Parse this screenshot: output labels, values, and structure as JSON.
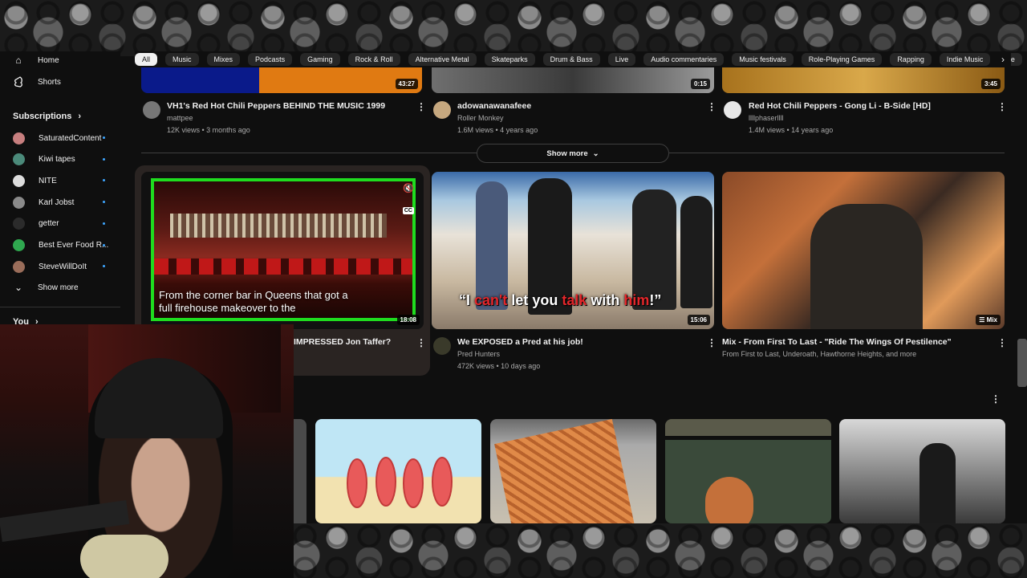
{
  "sidebar": {
    "home": "Home",
    "shorts": "Shorts",
    "subscriptions_heading": "Subscriptions",
    "subscriptions": [
      {
        "name": "SaturatedContent",
        "color": "#c77f7f"
      },
      {
        "name": "Kiwi tapes",
        "color": "#4b8a7a"
      },
      {
        "name": "NITE",
        "color": "#dddddd"
      },
      {
        "name": "Karl Jobst",
        "color": "#8a8a8a"
      },
      {
        "name": "getter",
        "color": "#2b2b2b"
      },
      {
        "name": "Best Ever Food R...",
        "color": "#2fa84f"
      },
      {
        "name": "SteveWillDoIt",
        "color": "#9a6d5a"
      }
    ],
    "show_more": "Show more",
    "you_heading": "You"
  },
  "chips": [
    "All",
    "Music",
    "Mixes",
    "Podcasts",
    "Gaming",
    "Rock & Roll",
    "Alternative Metal",
    "Skateparks",
    "Drum & Bass",
    "Live",
    "Audio commentaries",
    "Music festivals",
    "Role-Playing Games",
    "Rapping",
    "Indie Music",
    "Re"
  ],
  "row1": [
    {
      "duration": "43:27",
      "title": "VH1's Red Hot Chili Peppers BEHIND THE MUSIC 1999",
      "channel": "mattpee",
      "meta": "12K views • 3 months ago"
    },
    {
      "duration": "0:15",
      "title": "adowanawanafeee",
      "channel": "Roller Monkey",
      "meta": "1.6M views • 4 years ago"
    },
    {
      "duration": "3:45",
      "title": "Red Hot Chili Peppers - Gong Li - B-Side [HD]",
      "channel": "llllphaserllll",
      "meta": "1.4M views • 14 years ago"
    }
  ],
  "show_more_label": "Show more",
  "row2": [
    {
      "duration": "18:08",
      "caption_line1": "From the corner bar in Queens that got a",
      "caption_line2": "full firehouse makeover to the",
      "title": "IMPRESSED Jon Taffer?"
    },
    {
      "duration": "15:06",
      "overlay_text": [
        "“I ",
        "can't",
        " let you ",
        "talk",
        " with ",
        "him",
        "!”"
      ],
      "title": "We EXPOSED a Pred at his job!",
      "channel": "Pred Hunters",
      "meta": "472K views • 10 days ago"
    },
    {
      "duration": "Mix",
      "title": "Mix - From First To Last - \"Ride The Wings Of Pestilence\"",
      "channel": "From First to Last, Underoath, Hawthorne Heights, and more"
    }
  ],
  "colors": {
    "accent": "#3ea6ff",
    "caption_red": "#e3262a",
    "frame_green": "#1fdc1f"
  }
}
